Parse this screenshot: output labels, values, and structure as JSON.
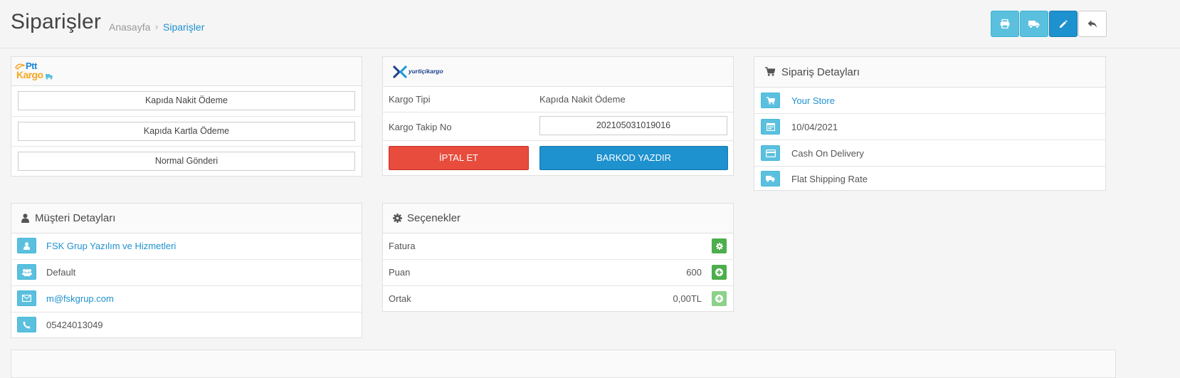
{
  "header": {
    "title": "Siparişler",
    "breadcrumb": {
      "home": "Anasayfa",
      "separator": "›",
      "current": "Siparişler"
    },
    "buttons": [
      {
        "icon": "print-icon"
      },
      {
        "icon": "truck-icon"
      },
      {
        "icon": "pencil-icon"
      },
      {
        "icon": "reply-icon"
      }
    ]
  },
  "ptt": {
    "logo_line1": "Ptt",
    "logo_line2": "Kargo",
    "options": [
      "Kapıda Nakit Ödeme",
      "Kapıda Kartla Ödeme",
      "Normal Gönderi"
    ]
  },
  "yurtici": {
    "logo_text": "yurtiçikargo",
    "kargo_tipi_label": "Kargo Tipi",
    "kargo_tipi_value": "Kapıda Nakit Ödeme",
    "takip_label": "Kargo Takip No",
    "takip_value": "202105031019016",
    "cancel_label": "İPTAL ET",
    "barcode_label": "BARKOD YAZDIR"
  },
  "order_details": {
    "title": "Sipariş Detayları",
    "store": "Your Store",
    "date": "10/04/2021",
    "payment": "Cash On Delivery",
    "shipping": "Flat Shipping Rate"
  },
  "customer": {
    "title": "Müşteri Detayları",
    "name": "FSK Grup Yazılım ve Hizmetleri",
    "group": "Default",
    "email": "m@fskgrup.com",
    "phone": "05424013049"
  },
  "options_panel": {
    "title": "Seçenekler",
    "rows": [
      {
        "label": "Fatura",
        "value": ""
      },
      {
        "label": "Puan",
        "value": "600"
      },
      {
        "label": "Ortak",
        "value": "0,00TL"
      }
    ]
  },
  "colors": {
    "accent": "#1e91cf",
    "info": "#5bc0de",
    "danger": "#e74c3c",
    "success": "#4cae4c"
  }
}
